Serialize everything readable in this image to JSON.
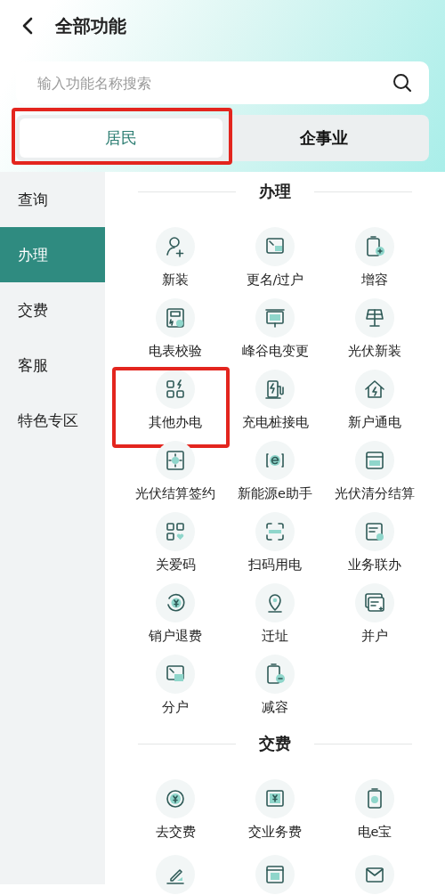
{
  "header": {
    "title": "全部功能"
  },
  "search": {
    "placeholder": "输入功能名称搜索"
  },
  "tabs": [
    {
      "label": "居民",
      "selected": true,
      "highlighted": true
    },
    {
      "label": "企事业",
      "selected": false,
      "highlighted": false
    }
  ],
  "sidebar": {
    "items": [
      {
        "label": "查询",
        "selected": false
      },
      {
        "label": "办理",
        "selected": true
      },
      {
        "label": "交费",
        "selected": false
      },
      {
        "label": "客服",
        "selected": false
      },
      {
        "label": "特色专区",
        "selected": false
      }
    ]
  },
  "sections": [
    {
      "title": "办理",
      "items": [
        {
          "label": "新装",
          "highlighted": false
        },
        {
          "label": "更名/过户",
          "highlighted": false
        },
        {
          "label": "增容",
          "highlighted": false
        },
        {
          "label": "电表校验",
          "highlighted": false
        },
        {
          "label": "峰谷电变更",
          "highlighted": false
        },
        {
          "label": "光伏新装",
          "highlighted": false
        },
        {
          "label": "其他办电",
          "highlighted": true
        },
        {
          "label": "充电桩接电",
          "highlighted": false
        },
        {
          "label": "新户通电",
          "highlighted": false
        },
        {
          "label": "光伏结算签约",
          "highlighted": false
        },
        {
          "label": "新能源e助手",
          "highlighted": false
        },
        {
          "label": "光伏清分结算",
          "highlighted": false
        },
        {
          "label": "关爱码",
          "highlighted": false
        },
        {
          "label": "扫码用电",
          "highlighted": false
        },
        {
          "label": "业务联办",
          "highlighted": false
        },
        {
          "label": "销户退费",
          "highlighted": false
        },
        {
          "label": "迁址",
          "highlighted": false
        },
        {
          "label": "并户",
          "highlighted": false
        },
        {
          "label": "分户",
          "highlighted": false
        },
        {
          "label": "减容",
          "highlighted": false
        }
      ]
    },
    {
      "title": "交费",
      "items": [
        {
          "label": "去交费",
          "highlighted": false
        },
        {
          "label": "交业务费",
          "highlighted": false
        },
        {
          "label": "电e宝",
          "highlighted": false
        },
        {
          "highlighted": false
        },
        {
          "highlighted": false
        },
        {
          "highlighted": false
        }
      ]
    }
  ]
}
